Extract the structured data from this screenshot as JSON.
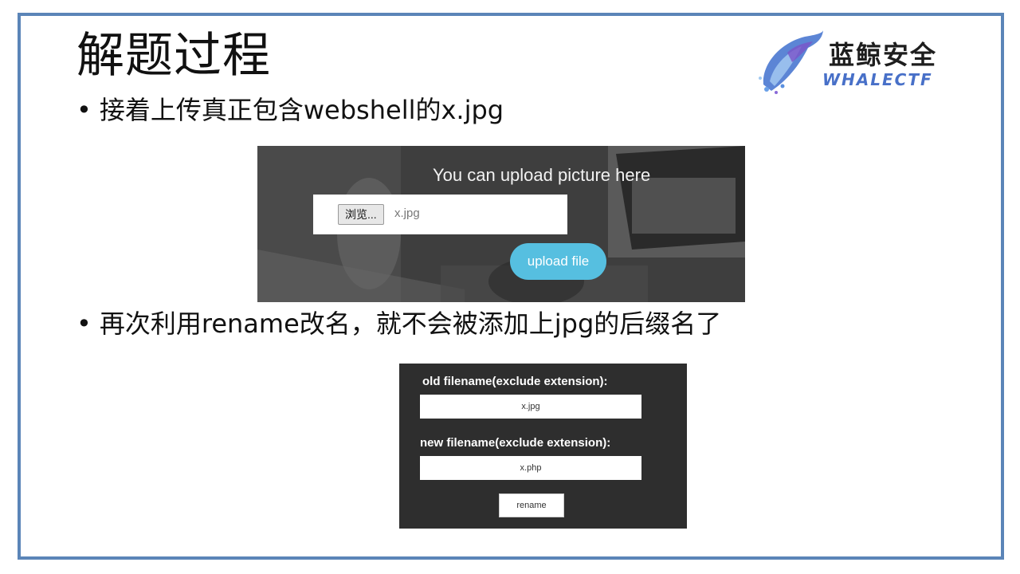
{
  "slide": {
    "title": "解题过程",
    "bullet1": "接着上传真正包含webshell的x.jpg",
    "bullet2": "再次利用rename改名，就不会被添加上jpg的后缀名了"
  },
  "logo": {
    "cn": "蓝鲸安全",
    "en": "WHALECTF"
  },
  "upload_panel": {
    "heading": "You can upload picture here",
    "browse_label": "浏览...",
    "file_value": "x.jpg",
    "upload_button": "upload file"
  },
  "rename_panel": {
    "old_label": "old filename(exclude extension):",
    "old_value": "x.jpg",
    "new_label": "new filename(exclude extension):",
    "new_value": "x.php",
    "rename_button": "rename"
  },
  "colors": {
    "frame_border": "#5b85b8",
    "upload_button": "#56bfe0",
    "logo_text_en": "#4870c8"
  }
}
